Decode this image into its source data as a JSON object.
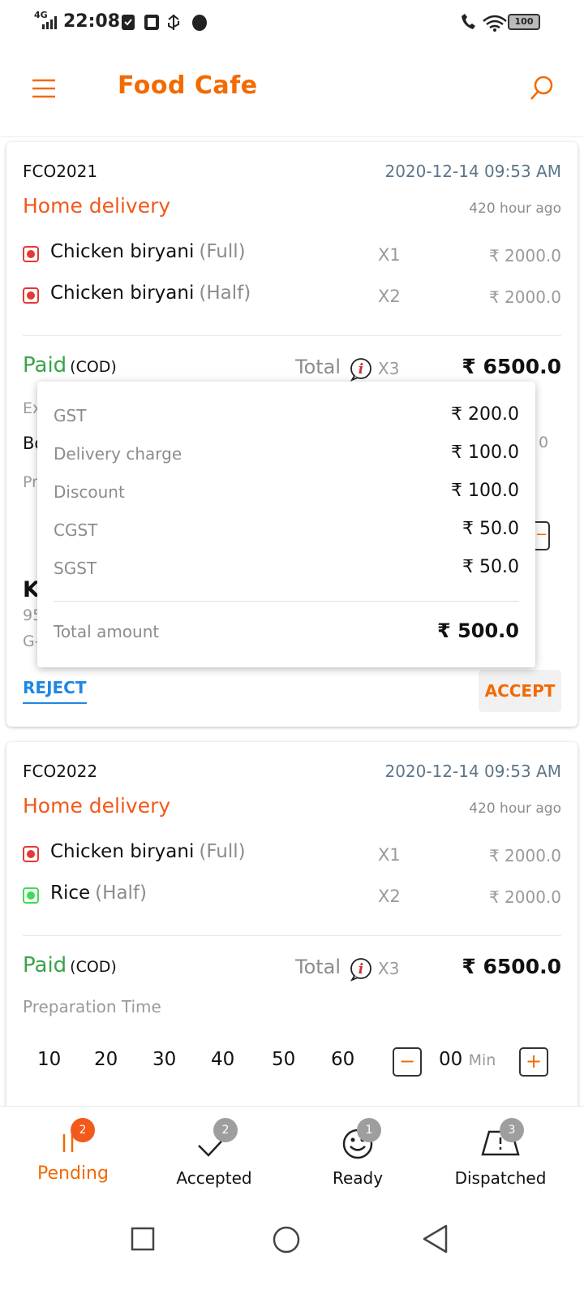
{
  "status_bar": {
    "network": "4G",
    "time": "22:08",
    "battery": "100"
  },
  "header": {
    "title": "Food Cafe",
    "menu_icon": "hamburger-icon",
    "search_icon": "search-icon"
  },
  "orders": [
    {
      "id": "FCO2021",
      "datetime": "2020-12-14 09:53 AM",
      "type": "Home delivery",
      "ago": "420 hour ago",
      "items": [
        {
          "name": "Chicken biryani",
          "variant": "(Full)",
          "qty": "X1",
          "price": "₹ 2000.0",
          "veg": false
        },
        {
          "name": "Chicken biryani",
          "variant": "(Half)",
          "qty": "X2",
          "price": "₹ 2000.0",
          "veg": false
        }
      ],
      "payment_status": "Paid",
      "payment_mode": "(COD)",
      "total_label": "Total",
      "total_qty": "X3",
      "total_amount": "₹ 6500.0",
      "partial_rows": {
        "row1": "Ex",
        "row2": "Bo",
        "row2_tail": "0",
        "row3": "Pr",
        "row4": "K",
        "row5": "95",
        "row6": "G-"
      },
      "reject_label": "REJECT",
      "accept_label": "ACCEPT"
    },
    {
      "id": "FCO2022",
      "datetime": "2020-12-14 09:53 AM",
      "type": "Home delivery",
      "ago": "420 hour ago",
      "items": [
        {
          "name": "Chicken biryani",
          "variant": "(Full)",
          "qty": "X1",
          "price": "₹ 2000.0",
          "veg": false
        },
        {
          "name": "Rice",
          "variant": "(Half)",
          "qty": "X2",
          "price": "₹ 2000.0",
          "veg": true
        }
      ],
      "payment_status": "Paid",
      "payment_mode": "(COD)",
      "total_label": "Total",
      "total_qty": "X3",
      "total_amount": "₹ 6500.0",
      "prep_label": "Preparation Time",
      "prep_options": [
        "10",
        "20",
        "30",
        "40",
        "50",
        "60"
      ],
      "prep_value": "00",
      "prep_unit": "Min"
    }
  ],
  "bill_popup": {
    "rows": [
      {
        "label": "GST",
        "value": "₹ 200.0"
      },
      {
        "label": "Delivery charge",
        "value": "₹ 100.0"
      },
      {
        "label": "Discount",
        "value": "₹ 100.0"
      },
      {
        "label": "CGST",
        "value": "₹ 50.0"
      },
      {
        "label": "SGST",
        "value": "₹ 50.0"
      }
    ],
    "total_label": "Total amount",
    "total_value": "₹ 500.0"
  },
  "bottom_nav": [
    {
      "label": "Pending",
      "badge": "2",
      "icon": "pending-icon",
      "active": true
    },
    {
      "label": "Accepted",
      "badge": "2",
      "icon": "check-icon",
      "active": false
    },
    {
      "label": "Ready",
      "badge": "1",
      "icon": "smiley-icon",
      "active": false
    },
    {
      "label": "Dispatched",
      "badge": "3",
      "icon": "dispatch-icon",
      "active": false
    }
  ],
  "colors": {
    "brand": "#f26a00",
    "order_type": "#f2591b",
    "paid": "#3aa34a",
    "link": "#1e88e5",
    "nonveg": "#e53935",
    "veg": "#3ddc52"
  }
}
